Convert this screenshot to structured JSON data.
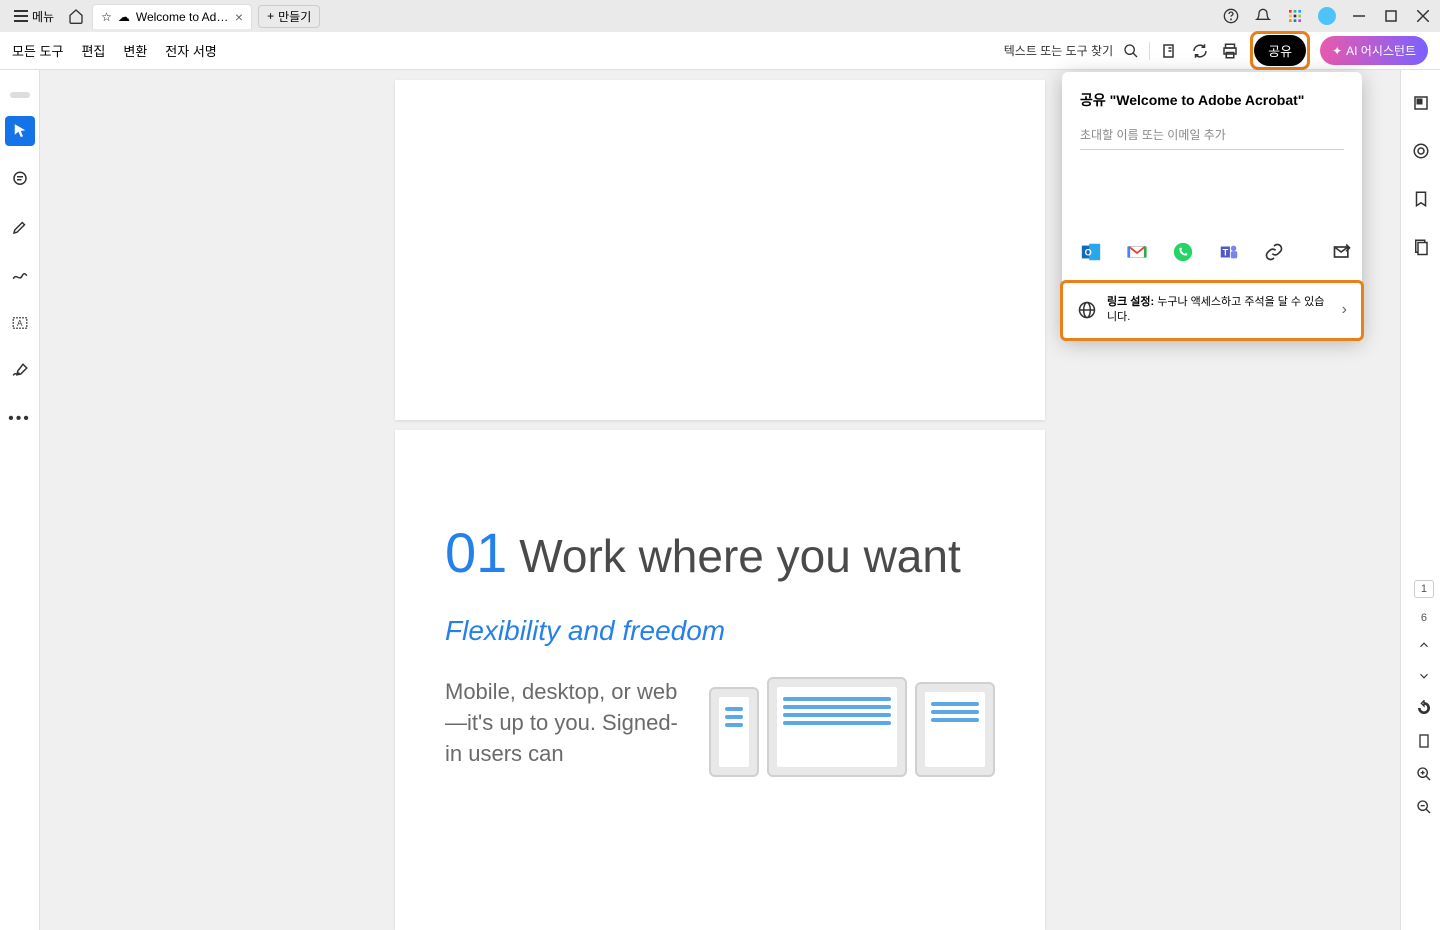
{
  "titlebar": {
    "menu_label": "메뉴",
    "tab_title": "Welcome to Ado...",
    "new_tab_label": "만들기"
  },
  "toolbar": {
    "all_tools": "모든 도구",
    "edit": "편집",
    "convert": "변환",
    "esign": "전자 서명",
    "search_label": "텍스트 또는 도구 찾기",
    "share": "공유",
    "ai": "AI 어시스턴트"
  },
  "popover": {
    "title": "공유 \"Welcome to Adobe Acrobat\"",
    "input_placeholder": "초대할 이름 또는 이메일 추가",
    "link_label": "링크 설정:",
    "link_desc": "누구나 액세스하고 주석을 달 수 있습니다."
  },
  "doc": {
    "num": "01",
    "heading": "Work where you want",
    "subhead": "Flexibility and freedom",
    "body": "Mobile, desktop, or web—it's up to you. Signed-in users can"
  },
  "pagenav": {
    "current": "1",
    "total": "6"
  }
}
